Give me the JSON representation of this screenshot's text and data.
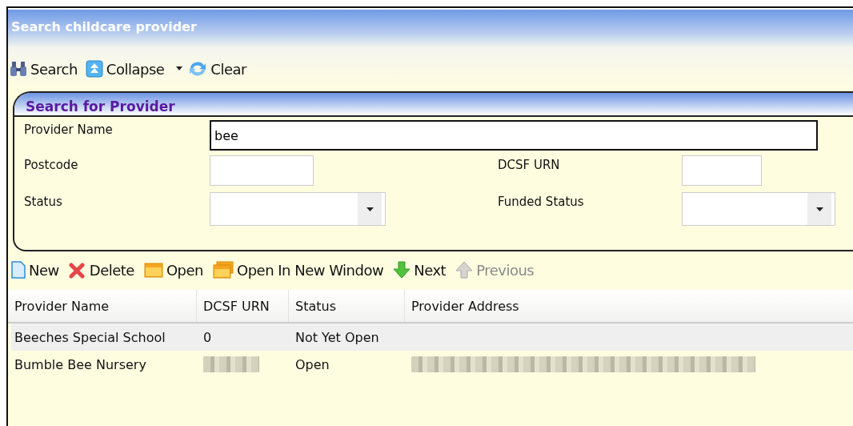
{
  "window": {
    "title": "Search childcare provider"
  },
  "toolbar": [
    {
      "kind": "binoculars",
      "label": "Search"
    },
    {
      "kind": "collapse",
      "label": "Collapse"
    },
    {
      "kind": "dropdown"
    },
    {
      "kind": "refresh",
      "label": "Clear"
    }
  ],
  "search_panel": {
    "title": "Search for Provider",
    "fields": [
      {
        "label": "Provider Name",
        "kind": "text",
        "value": "bee",
        "focused": true
      },
      {
        "label": "Postcode",
        "kind": "text",
        "focused": false
      },
      {
        "label": "DCSF URN",
        "kind": "text",
        "focused": false
      },
      {
        "label": "Status",
        "kind": "select",
        "focused": false
      },
      {
        "label": "Funded Status",
        "kind": "select",
        "focused": false
      }
    ]
  },
  "actions": [
    {
      "kind": "page",
      "label": "New",
      "disabled": false
    },
    {
      "kind": "delete",
      "label": "Delete",
      "disabled": false
    },
    {
      "kind": "folder",
      "label": "Open",
      "disabled": false
    },
    {
      "kind": "folders",
      "label": "Open In New Window",
      "disabled": false
    },
    {
      "kind": "down",
      "label": "Next",
      "disabled": false
    },
    {
      "kind": "up",
      "label": "Previous",
      "disabled": true
    }
  ],
  "table": {
    "columns": [
      "Provider Name",
      "DCSF URN",
      "Status",
      "Provider Address"
    ],
    "rows": [
      {
        "selected": true,
        "cells": [
          {
            "text": "Beeches Special School"
          },
          {
            "text": "0"
          },
          {
            "text": "Not Yet Open"
          }
        ]
      },
      {
        "selected": false,
        "cells": [
          {
            "text": "Bumble Bee Nursery"
          },
          {
            "redacted": true
          },
          {
            "text": "Open"
          },
          {
            "redacted": true
          }
        ]
      }
    ]
  }
}
